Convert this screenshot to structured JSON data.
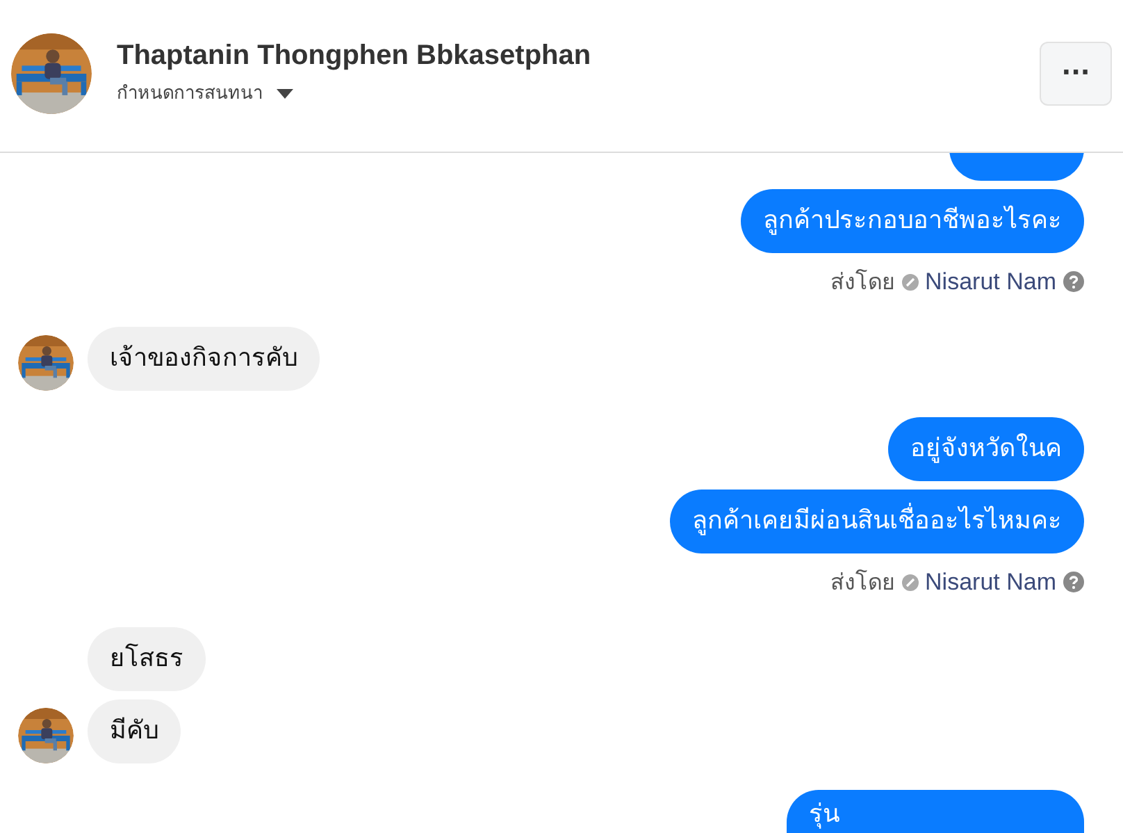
{
  "header": {
    "name": "Thaptanin Thongphen Bbkasetphan",
    "subtitle": "กำหนดการสนทนา",
    "more_button": "···"
  },
  "groups": [
    {
      "kind": "sent",
      "clipped_bubble": true,
      "messages": [
        "ลูกค้าประกอบอาชีพอะไรคะ"
      ],
      "sent_by": {
        "label": "ส่งโดย",
        "name": "Nisarut Nam"
      }
    },
    {
      "kind": "received",
      "messages": [
        "เจ้าของกิจการคับ"
      ]
    },
    {
      "kind": "sent",
      "messages": [
        "อยู่จังหวัดในค",
        "ลูกค้าเคยมีผ่อนสินเชื่ออะไรไหมคะ"
      ],
      "sent_by": {
        "label": "ส่งโดย",
        "name": "Nisarut Nam"
      }
    },
    {
      "kind": "received",
      "messages": [
        "ยโสธร",
        "มีคับ"
      ]
    },
    {
      "kind": "sent",
      "cut_off": true,
      "messages": [
        "รุ่น"
      ]
    }
  ]
}
